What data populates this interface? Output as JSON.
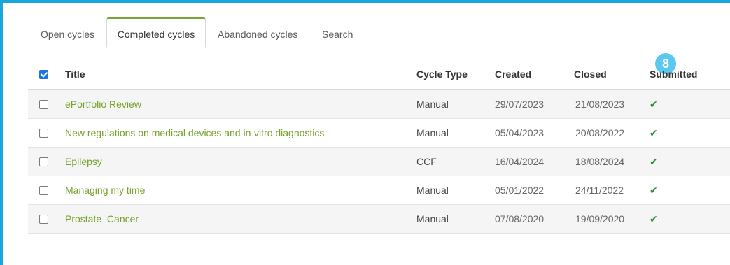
{
  "tabs": [
    {
      "label": "Open cycles"
    },
    {
      "label": "Completed cycles"
    },
    {
      "label": "Abandoned cycles"
    },
    {
      "label": "Search"
    }
  ],
  "badge": "8",
  "table": {
    "headers": {
      "title": "Title",
      "cycle_type": "Cycle Type",
      "created": "Created",
      "closed": "Closed",
      "submitted": "Submitted"
    },
    "select_all_checked": true,
    "rows": [
      {
        "title": "ePortfolio Review",
        "cycle_type": "Manual",
        "created": "29/07/2023",
        "closed": "21/08/2023",
        "submitted": "✔"
      },
      {
        "title": "New regulations on medical devices and in-vitro diagnostics",
        "cycle_type": "Manual",
        "created": "05/04/2023",
        "closed": "20/08/2022",
        "submitted": "✔"
      },
      {
        "title": "Epilepsy",
        "cycle_type": "CCF",
        "created": "16/04/2024",
        "closed": "18/08/2024",
        "submitted": "✔"
      },
      {
        "title": "Managing my time",
        "cycle_type": "Manual",
        "created": "05/01/2022",
        "closed": "24/11/2022",
        "submitted": "✔"
      },
      {
        "title": "Prostate  Cancer",
        "cycle_type": "Manual",
        "created": "07/08/2020",
        "closed": "19/09/2020",
        "submitted": "✔"
      }
    ]
  },
  "colors": {
    "frame": "#19a6dd",
    "link": "#75a22a",
    "active_tab_accent": "#75a830",
    "check": "#2e8b2e",
    "badge": "#5bc8f0"
  }
}
